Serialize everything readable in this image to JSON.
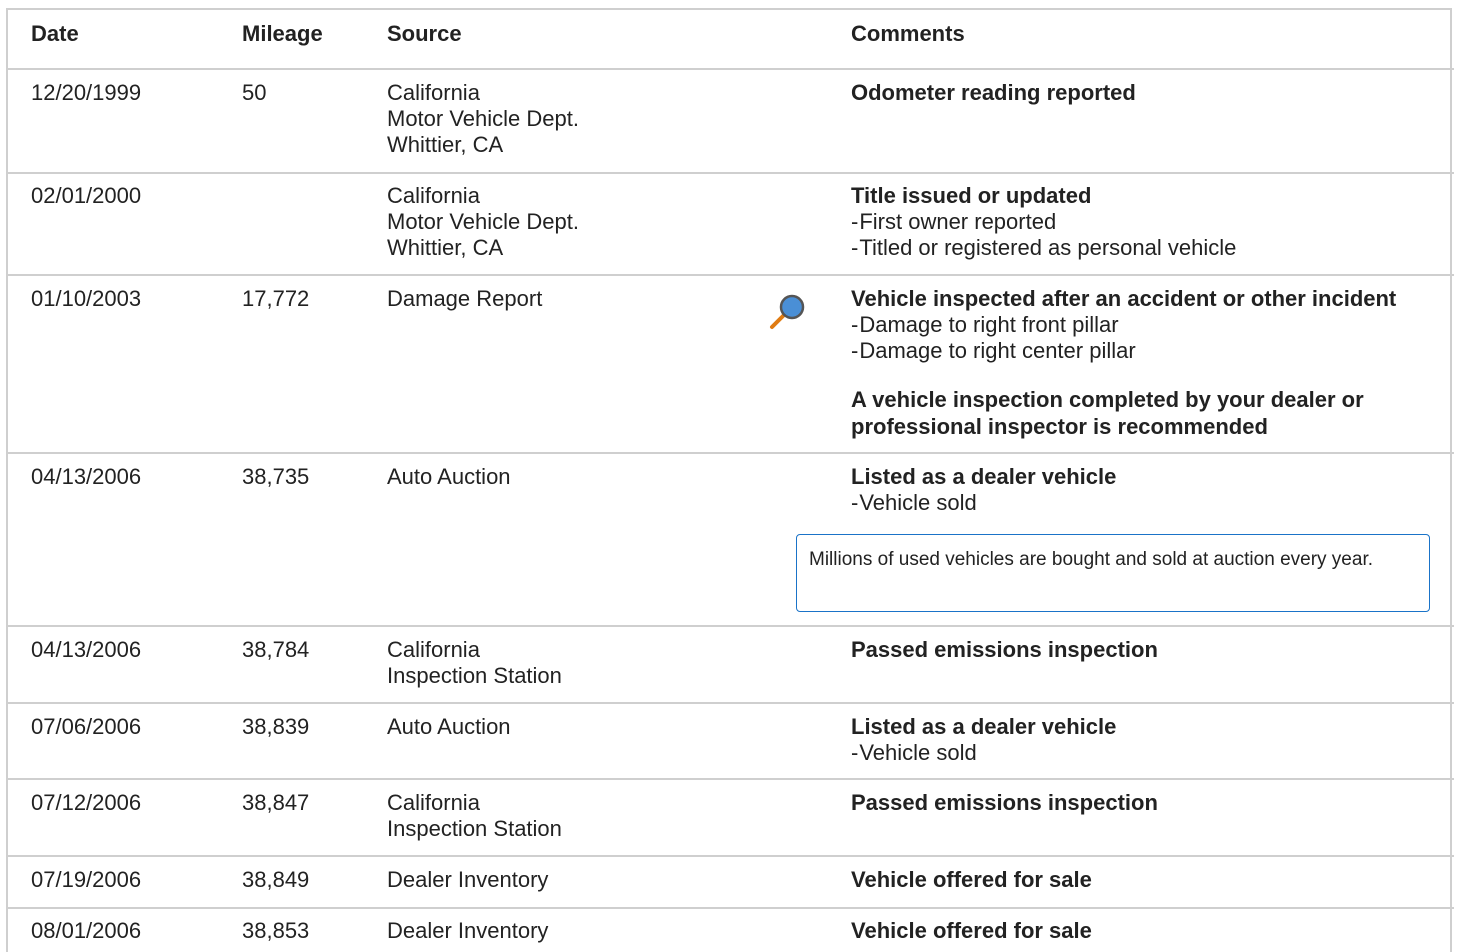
{
  "headers": {
    "date": "Date",
    "mileage": "Mileage",
    "source": "Source",
    "comments": "Comments"
  },
  "rows": [
    {
      "date": "12/20/1999",
      "mileage": "50",
      "source": [
        "California",
        "Motor Vehicle Dept.",
        "Whittier, CA"
      ],
      "title": "Odometer reading reported",
      "details": []
    },
    {
      "date": "02/01/2000",
      "mileage": "",
      "source": [
        "California",
        "Motor Vehicle Dept.",
        "Whittier, CA"
      ],
      "title": "Title issued or updated",
      "details": [
        "First owner reported",
        "Titled or registered as personal vehicle"
      ]
    },
    {
      "date": "01/10/2003",
      "mileage": "17,772",
      "source": [
        "Damage Report"
      ],
      "title": "Vehicle inspected after an accident or other incident",
      "details": [
        "Damage to right front pillar",
        "Damage to right center pillar"
      ],
      "recommendation": [
        "A vehicle inspection completed by your dealer or",
        "professional inspector is recommended"
      ],
      "icon": "magnifier-icon"
    },
    {
      "date": "04/13/2006",
      "mileage": "38,735",
      "source": [
        "Auto Auction"
      ],
      "title": "Listed as a dealer vehicle",
      "details": [
        "Vehicle sold"
      ],
      "note": "Millions of used vehicles are bought and sold at auction every year."
    },
    {
      "date": "04/13/2006",
      "mileage": "38,784",
      "source": [
        "California",
        "Inspection Station"
      ],
      "title": "Passed emissions inspection",
      "details": []
    },
    {
      "date": "07/06/2006",
      "mileage": "38,839",
      "source": [
        "Auto Auction"
      ],
      "title": "Listed as a dealer vehicle",
      "details": [
        "Vehicle sold"
      ]
    },
    {
      "date": "07/12/2006",
      "mileage": "38,847",
      "source": [
        "California",
        "Inspection Station"
      ],
      "title": "Passed emissions inspection",
      "details": []
    },
    {
      "date": "07/19/2006",
      "mileage": "38,849",
      "source": [
        "Dealer Inventory"
      ],
      "title": "Vehicle offered for sale",
      "details": []
    },
    {
      "date": "08/01/2006",
      "mileage": "38,853",
      "source": [
        "Dealer Inventory"
      ],
      "title": "Vehicle offered for sale",
      "details": []
    }
  ],
  "colors": {
    "border": "#cfcfcf",
    "note_border": "#1a73c8",
    "icon_lens": "#4a8fd6",
    "icon_handle": "#e07b12"
  }
}
